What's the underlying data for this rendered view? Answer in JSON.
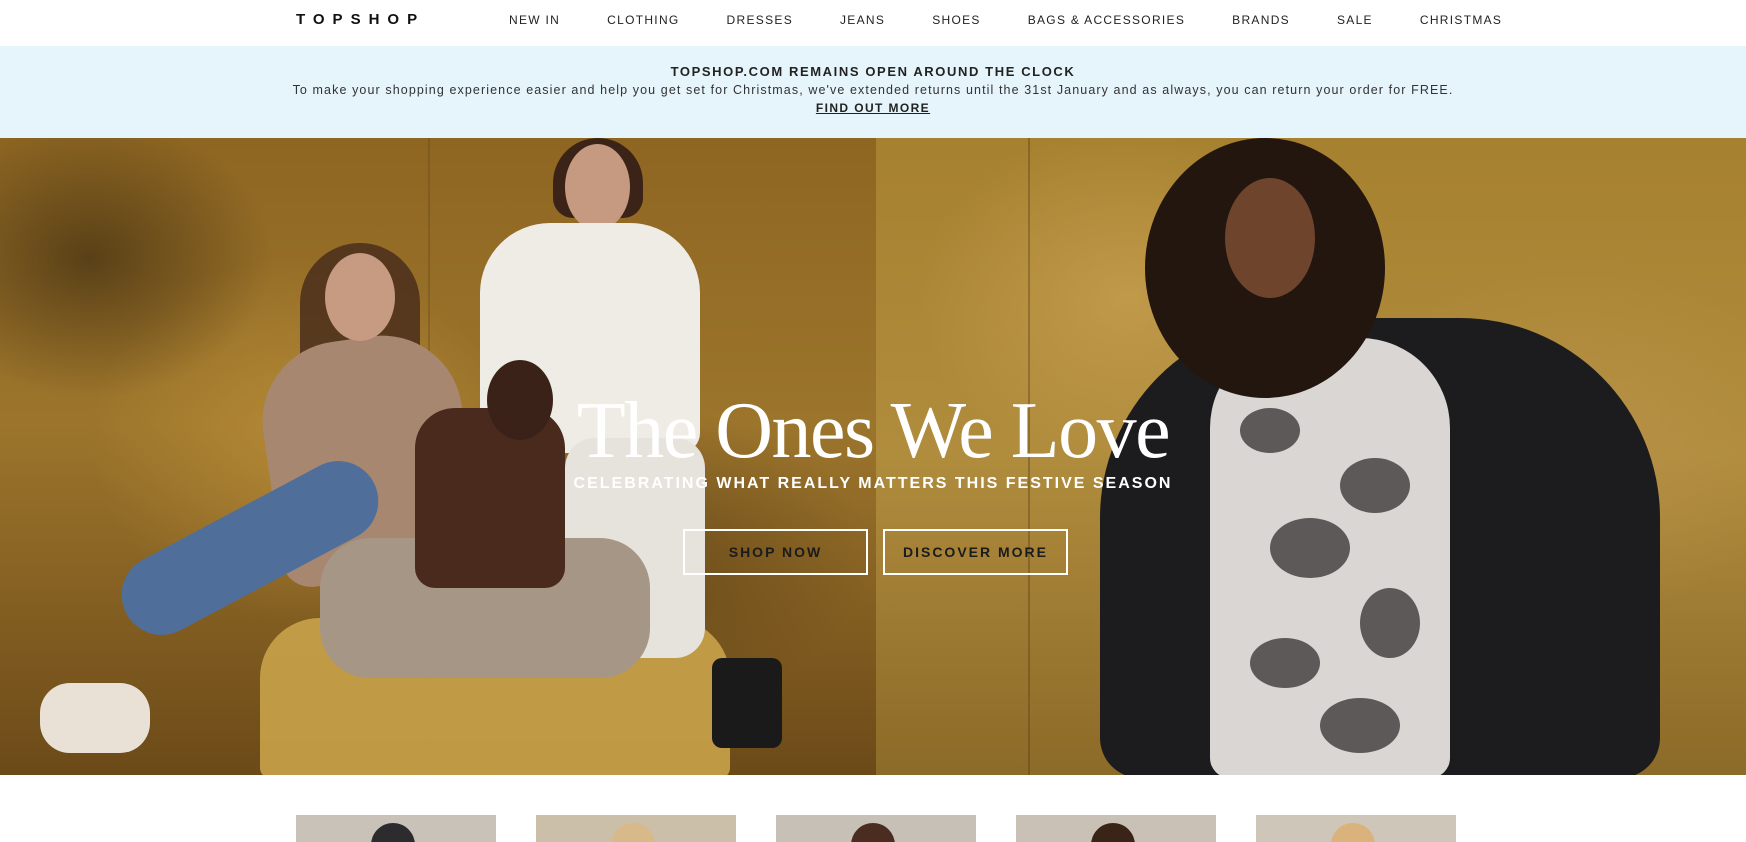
{
  "nav": {
    "logo": "TOPSHOP",
    "links": [
      "NEW IN",
      "CLOTHING",
      "DRESSES",
      "JEANS",
      "SHOES",
      "BAGS & ACCESSORIES",
      "BRANDS",
      "SALE",
      "CHRISTMAS"
    ]
  },
  "banner": {
    "title": "TOPSHOP.COM REMAINS OPEN AROUND THE CLOCK",
    "text": "To make your shopping experience easier and help you get set for Christmas, we've extended returns until the 31st January and as always, you can return your order for FREE.",
    "link": "FIND OUT MORE",
    "background": "#e6f5fb"
  },
  "hero": {
    "title": "The Ones We Love",
    "subtitle": "CELEBRATING WHAT REALLY MATTERS THIS FESTIVE SEASON",
    "buttons": {
      "shop": "SHOP NOW",
      "discover": "DISCOVER MORE"
    },
    "accent": "#a27a2b"
  },
  "tiles": [
    {
      "bg": "#c9c2b8",
      "tone": "#2c2c2e"
    },
    {
      "bg": "#cbbfa9",
      "tone": "#d8b98a"
    },
    {
      "bg": "#c7c0b6",
      "tone": "#4a2c20"
    },
    {
      "bg": "#c9c1b5",
      "tone": "#3a2418"
    },
    {
      "bg": "#cdc6b9",
      "tone": "#d9b27c"
    }
  ]
}
